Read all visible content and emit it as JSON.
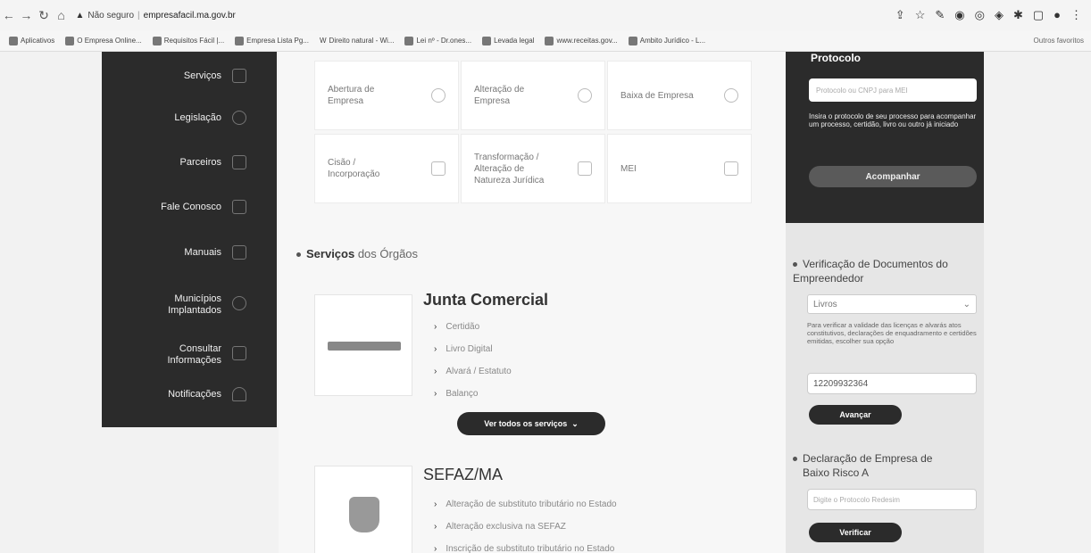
{
  "browser": {
    "insecure_label": "Não seguro",
    "url": "empresafacil.ma.gov.br",
    "bookmarks": [
      "Aplicativos",
      "O Empresa Online...",
      "Requisitos Fácil |...",
      "Empresa Lista Pg...",
      "Direito natural - Wi...",
      "Lei nº - Dr.ones...",
      "Levada legal",
      "www.receitas.gov...",
      "Ambito Jurídico - L..."
    ],
    "bookmarks_right": "Outros favoritos"
  },
  "sidebar": {
    "items": [
      {
        "label": "Serviços"
      },
      {
        "label": "Legislação"
      },
      {
        "label": "Parceiros"
      },
      {
        "label": "Fale Conosco"
      },
      {
        "label": "Manuais"
      },
      {
        "label": "Municípios Implantados"
      },
      {
        "label": "Consultar Informações"
      },
      {
        "label": "Notificações"
      }
    ]
  },
  "cards": [
    {
      "label": "Abertura de Empresa"
    },
    {
      "label": "Alteração de Empresa"
    },
    {
      "label": "Baixa de Empresa"
    },
    {
      "label": "Cisão / Incorporação"
    },
    {
      "label": "Transformação / Alteração de Natureza Jurídica"
    },
    {
      "label": "MEI"
    }
  ],
  "section": {
    "title_bold": "Serviços",
    "title_light": "dos Órgãos"
  },
  "orgs": [
    {
      "name": "Junta Comercial",
      "services": [
        "Certidão",
        "Livro Digital",
        "Alvará / Estatuto",
        "Balanço"
      ],
      "button": "Ver todos os serviços"
    },
    {
      "name": "SEFAZ/MA",
      "services": [
        "Alteração de substituto tributário no Estado",
        "Alteração exclusiva na SEFAZ",
        "Inscrição de substituto tributário no Estado"
      ]
    }
  ],
  "protocol": {
    "title": "Protocolo",
    "input_placeholder": "Protocolo ou CNPJ para MEI",
    "help_text": "Insira o protocolo de seu processo para acompanhar um processo, certidão, livro ou outro já iniciado",
    "button": "Acompanhar"
  },
  "verification": {
    "title": "Verificação de Documentos do Empreendedor",
    "select_value": "Livros",
    "note": "Para verificar a validade das licenças e alvarás atos constitutivos, declarações de enquadramento e certidões emitidas, escolher sua opção",
    "field_value": "12209932364",
    "button": "Avançar"
  },
  "declaration": {
    "title_line1": "Declaração de Empresa de",
    "title_line2": "Baixo Risco A",
    "input_placeholder": "Digite o Protocolo Redesim",
    "button": "Verificar"
  }
}
